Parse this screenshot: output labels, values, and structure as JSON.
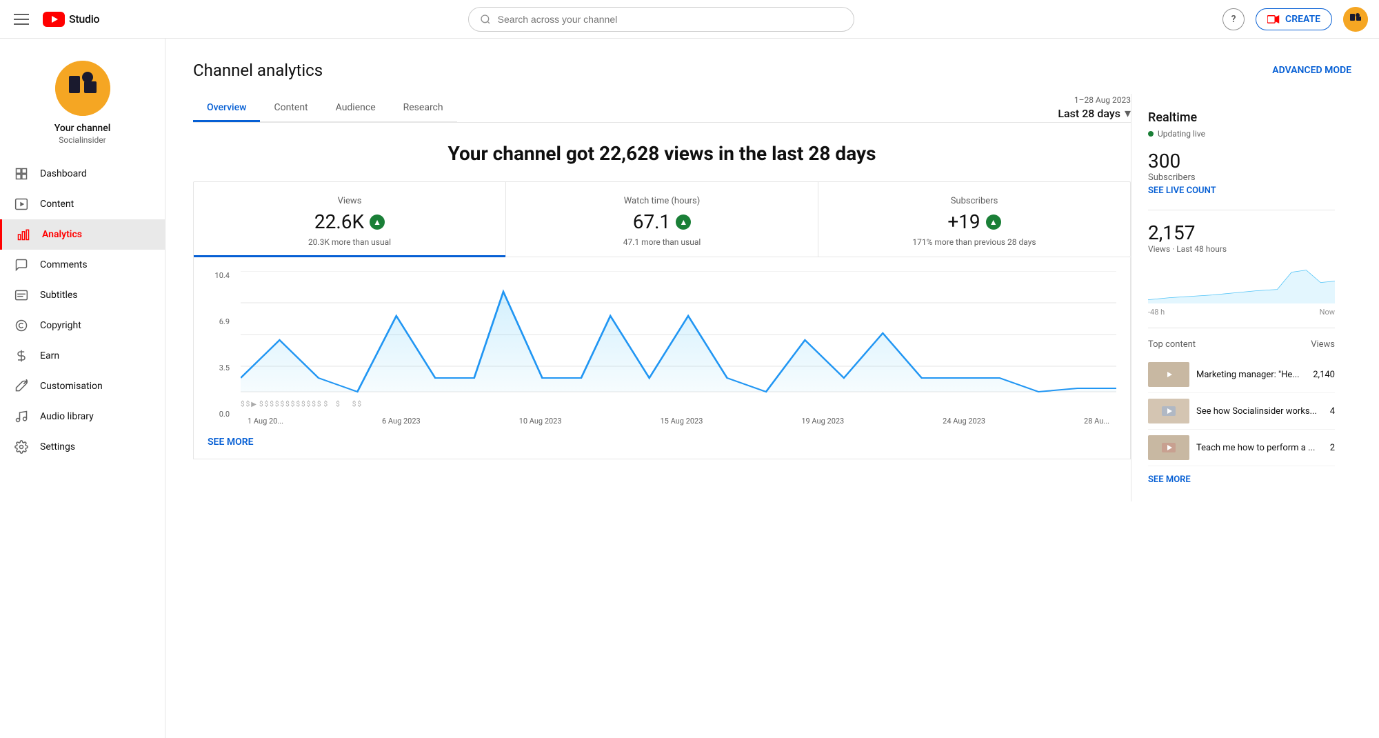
{
  "topnav": {
    "search_placeholder": "Search across your channel",
    "create_label": "CREATE",
    "logo_text": "Studio"
  },
  "sidebar": {
    "channel_name": "Your channel",
    "channel_handle": "Socialinsider",
    "nav_items": [
      {
        "id": "dashboard",
        "label": "Dashboard",
        "icon": "grid"
      },
      {
        "id": "content",
        "label": "Content",
        "icon": "play-square"
      },
      {
        "id": "analytics",
        "label": "Analytics",
        "icon": "bar-chart",
        "active": true
      },
      {
        "id": "comments",
        "label": "Comments",
        "icon": "comment"
      },
      {
        "id": "subtitles",
        "label": "Subtitles",
        "icon": "subtitles"
      },
      {
        "id": "copyright",
        "label": "Copyright",
        "icon": "copyright"
      },
      {
        "id": "earn",
        "label": "Earn",
        "icon": "dollar"
      },
      {
        "id": "customisation",
        "label": "Customisation",
        "icon": "brush"
      },
      {
        "id": "audio_library",
        "label": "Audio library",
        "icon": "music"
      },
      {
        "id": "settings",
        "label": "Settings",
        "icon": "gear"
      }
    ]
  },
  "analytics": {
    "page_title": "Channel analytics",
    "advanced_mode": "ADVANCED MODE",
    "tabs": [
      "Overview",
      "Content",
      "Audience",
      "Research"
    ],
    "active_tab": "Overview",
    "date_range": "1–28 Aug 2023",
    "date_label": "Last 28 days",
    "headline": "Your channel got 22,628 views in the last 28 days",
    "metrics": [
      {
        "label": "Views",
        "value": "22.6K",
        "arrow": true,
        "sub": "20.3K more than usual"
      },
      {
        "label": "Watch time (hours)",
        "value": "67.1",
        "arrow": true,
        "sub": "47.1 more than usual"
      },
      {
        "label": "Subscribers",
        "value": "+19",
        "arrow": true,
        "sub": "171% more than previous 28 days"
      }
    ],
    "chart_y_labels": [
      "10.4",
      "6.9",
      "3.5",
      "0.0"
    ],
    "chart_x_labels": [
      "1 Aug 20...",
      "6 Aug 2023",
      "10 Aug 2023",
      "15 Aug 2023",
      "19 Aug 2023",
      "24 Aug 2023",
      "28 Au..."
    ],
    "see_more": "SEE MORE"
  },
  "realtime": {
    "title": "Realtime",
    "live_label": "Updating live",
    "subscribers_count": "300",
    "subscribers_label": "Subscribers",
    "see_live_count": "SEE LIVE COUNT",
    "views_count": "2,157",
    "views_label": "Views · Last 48 hours",
    "mini_chart_labels": [
      "-48 h",
      "Now"
    ],
    "top_content_label": "Top content",
    "top_content_views_label": "Views",
    "top_content_items": [
      {
        "title": "Marketing manager: \"He...",
        "views": "2,140"
      },
      {
        "title": "See how Socialinsider works...",
        "views": "4"
      },
      {
        "title": "Teach me how to perform a ...",
        "views": "2"
      }
    ],
    "see_more": "SEE MORE"
  }
}
